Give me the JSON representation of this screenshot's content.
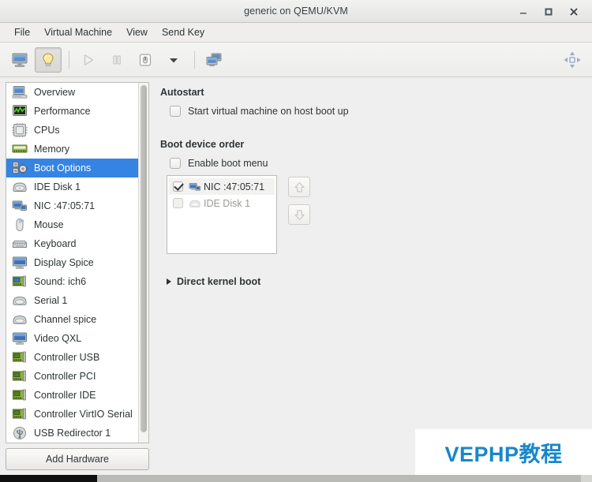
{
  "window": {
    "title": "generic on QEMU/KVM",
    "controls": [
      {
        "name": "minimize",
        "glyph": "minimize-icon"
      },
      {
        "name": "maximize",
        "glyph": "maximize-icon"
      },
      {
        "name": "close",
        "glyph": "close-icon"
      }
    ]
  },
  "menubar": {
    "items": [
      {
        "label": "File"
      },
      {
        "label": "Virtual Machine"
      },
      {
        "label": "View"
      },
      {
        "label": "Send Key"
      }
    ]
  },
  "toolbar": {
    "buttons": [
      {
        "name": "show-console",
        "icon": "monitor-icon",
        "active": false
      },
      {
        "name": "show-details",
        "icon": "lightbulb-icon",
        "active": true
      },
      {
        "name": "run",
        "icon": "play-icon",
        "active": false
      },
      {
        "name": "pause",
        "icon": "pause-icon",
        "active": false
      },
      {
        "name": "shutdown",
        "icon": "shutdown-icon",
        "active": false
      },
      {
        "name": "shutdown-menu",
        "icon": "chevron-down-icon",
        "active": false
      },
      {
        "name": "snapshots",
        "icon": "snapshots-icon",
        "active": false
      }
    ],
    "fullscreen": {
      "name": "fullscreen",
      "icon": "expand-arrows-icon"
    }
  },
  "sidebar": {
    "selected_index": 4,
    "items": [
      {
        "label": "Overview",
        "icon": "computer-icon"
      },
      {
        "label": "Performance",
        "icon": "graph-icon"
      },
      {
        "label": "CPUs",
        "icon": "cpu-chip-icon"
      },
      {
        "label": "Memory",
        "icon": "memory-stick-icon"
      },
      {
        "label": "Boot Options",
        "icon": "boot-gear-icon"
      },
      {
        "label": "IDE Disk 1",
        "icon": "harddisk-icon"
      },
      {
        "label": "NIC :47:05:71",
        "icon": "network-icon"
      },
      {
        "label": "Mouse",
        "icon": "mouse-icon"
      },
      {
        "label": "Keyboard",
        "icon": "keyboard-icon"
      },
      {
        "label": "Display Spice",
        "icon": "display-icon"
      },
      {
        "label": "Sound: ich6",
        "icon": "sound-card-icon"
      },
      {
        "label": "Serial 1",
        "icon": "serial-port-icon"
      },
      {
        "label": "Channel spice",
        "icon": "channel-icon"
      },
      {
        "label": "Video QXL",
        "icon": "video-icon"
      },
      {
        "label": "Controller USB",
        "icon": "controller-card-icon"
      },
      {
        "label": "Controller PCI",
        "icon": "controller-card-icon"
      },
      {
        "label": "Controller IDE",
        "icon": "controller-card-icon"
      },
      {
        "label": "Controller VirtIO Serial",
        "icon": "controller-card-icon"
      },
      {
        "label": "USB Redirector 1",
        "icon": "usb-icon"
      }
    ],
    "add_hardware_label": "Add Hardware"
  },
  "main": {
    "autostart": {
      "title": "Autostart",
      "checkbox_label": "Start virtual machine on host boot up",
      "checked": false
    },
    "boot_order": {
      "title": "Boot device order",
      "enable_menu_label": "Enable boot menu",
      "enable_menu_checked": false,
      "devices": [
        {
          "label": "NIC :47:05:71",
          "checked": true,
          "enabled": true,
          "selected": true,
          "icon": "network-icon"
        },
        {
          "label": "IDE Disk 1",
          "checked": false,
          "enabled": false,
          "selected": false,
          "icon": "harddisk-icon"
        }
      ],
      "move_up_label": "Move up",
      "move_down_label": "Move down"
    },
    "kernel_boot": {
      "label": "Direct kernel boot",
      "expanded": false
    }
  },
  "watermark": {
    "text": "VEPHP教程",
    "color": "#1887c9"
  },
  "theme": {
    "selection_blue": "#3584e4",
    "panel_bg": "#efefef",
    "list_bg": "#ffffff",
    "text": "#2e3436"
  }
}
